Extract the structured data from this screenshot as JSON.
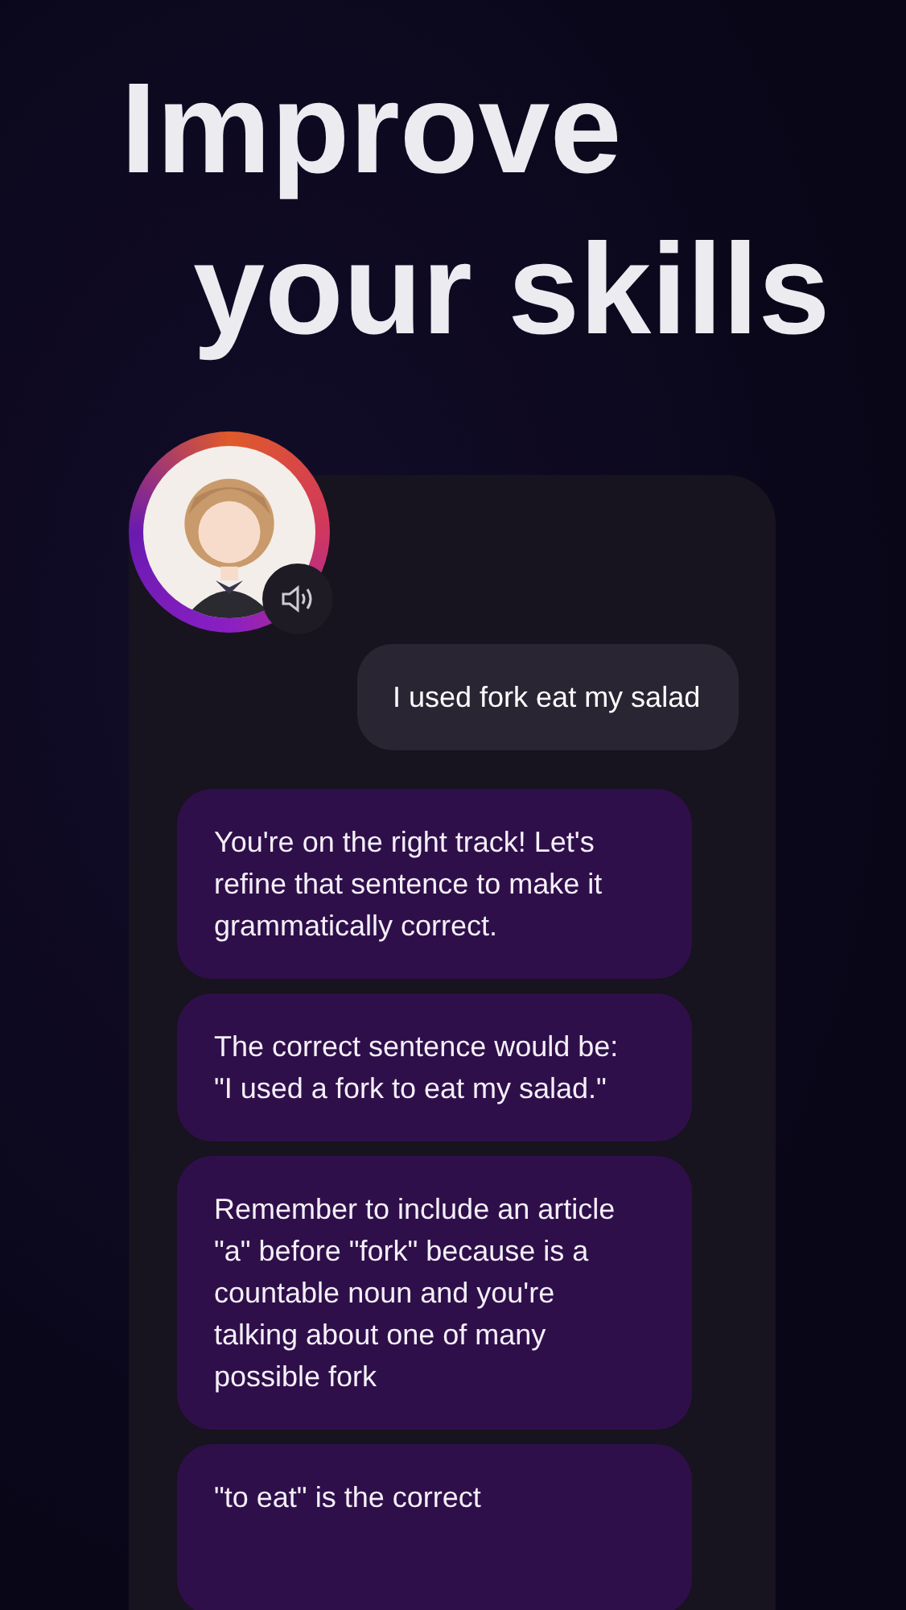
{
  "headline": [
    "Improve",
    "your skills"
  ],
  "messages": [
    {
      "kind": "user",
      "text": "I used fork eat my salad"
    },
    {
      "kind": "bot",
      "text": "You're on the right track! Let's refine that sentence to make it grammatically correct."
    },
    {
      "kind": "bot",
      "text": "The correct sentence would be: \"I used a fork to eat my salad.\""
    },
    {
      "kind": "bot",
      "text": "Remember to include an article \"a\" before \"fork\" because is a countable noun and you're talking about one of many possible fork"
    },
    {
      "kind": "bot",
      "text": "\"to eat\" is the correct"
    }
  ]
}
